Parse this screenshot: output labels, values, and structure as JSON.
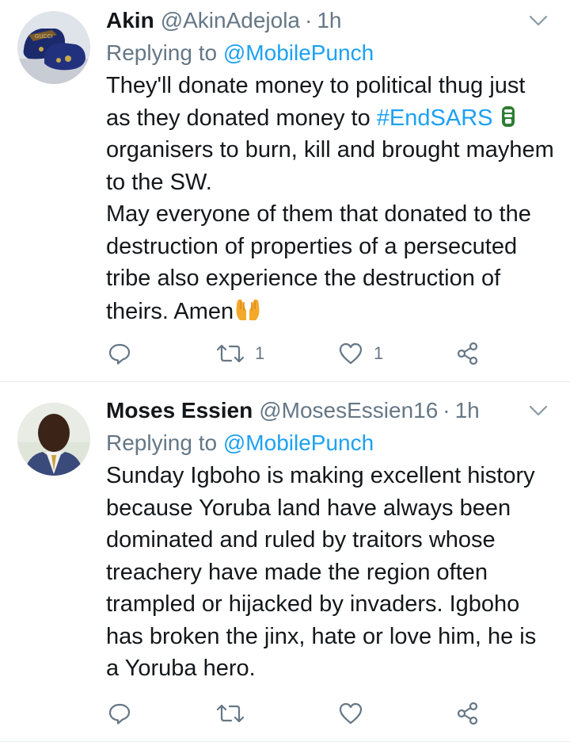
{
  "tweets": [
    {
      "name": "Akin",
      "handle": "@AkinAdejola",
      "separator": "·",
      "time": "1h",
      "replying_prefix": "Replying to",
      "replying_to": "@MobilePunch",
      "body_pre": "They'll donate money to political thug just as they donated money to ",
      "hashtag": "#EndSARS",
      "body_post": " organisers to burn, kill and brought mayhem to the SW.",
      "body_line2": "May everyone of them that donated to the destruction of properties of a persecuted tribe also experience the destruction of theirs. Amen",
      "retweet_count": "1",
      "like_count": "1",
      "avatar_icon": "shoes-avatar",
      "avatar_label": "GUCCI"
    },
    {
      "name": "Moses Essien",
      "handle": "@MosesEssien16",
      "separator": "·",
      "time": "1h",
      "replying_prefix": "Replying to",
      "replying_to": "@MobilePunch",
      "body": "Sunday Igboho is making excellent history because Yoruba land have always been dominated and ruled by traitors whose treachery have made the region often trampled or hijacked by invaders. Igboho has broken the jinx, hate or love him, he is a Yoruba hero.",
      "retweet_count": "",
      "like_count": "",
      "avatar_icon": "man-portrait-avatar"
    }
  ],
  "colors": {
    "link": "#1da1f2",
    "muted": "#657786",
    "text": "#14171a",
    "divider": "#e6ecf0"
  }
}
